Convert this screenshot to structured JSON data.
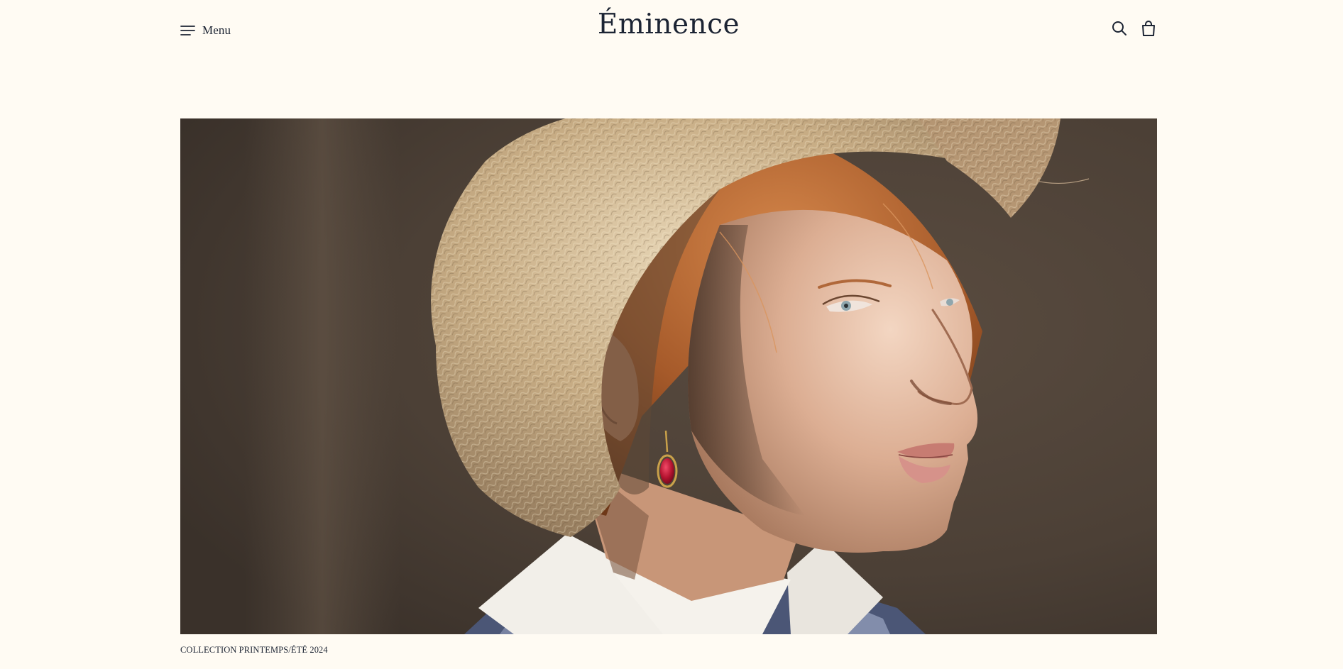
{
  "header": {
    "menu_label": "Menu",
    "logo_text": "Éminence",
    "menu_icon": "hamburger-icon",
    "search_icon": "search-icon",
    "cart_icon": "shopping-bag-icon"
  },
  "hero": {
    "caption": "COLLECTION PRINTEMPS/ÉTÉ 2024"
  },
  "colors": {
    "background": "#fffbf3",
    "text": "#1c2433",
    "hero_backdrop": "#4a3f35",
    "straw_hat": "#c9b08a",
    "hair": "#b5652e",
    "skin": "#d9a98e",
    "earring": "#b4132f"
  }
}
